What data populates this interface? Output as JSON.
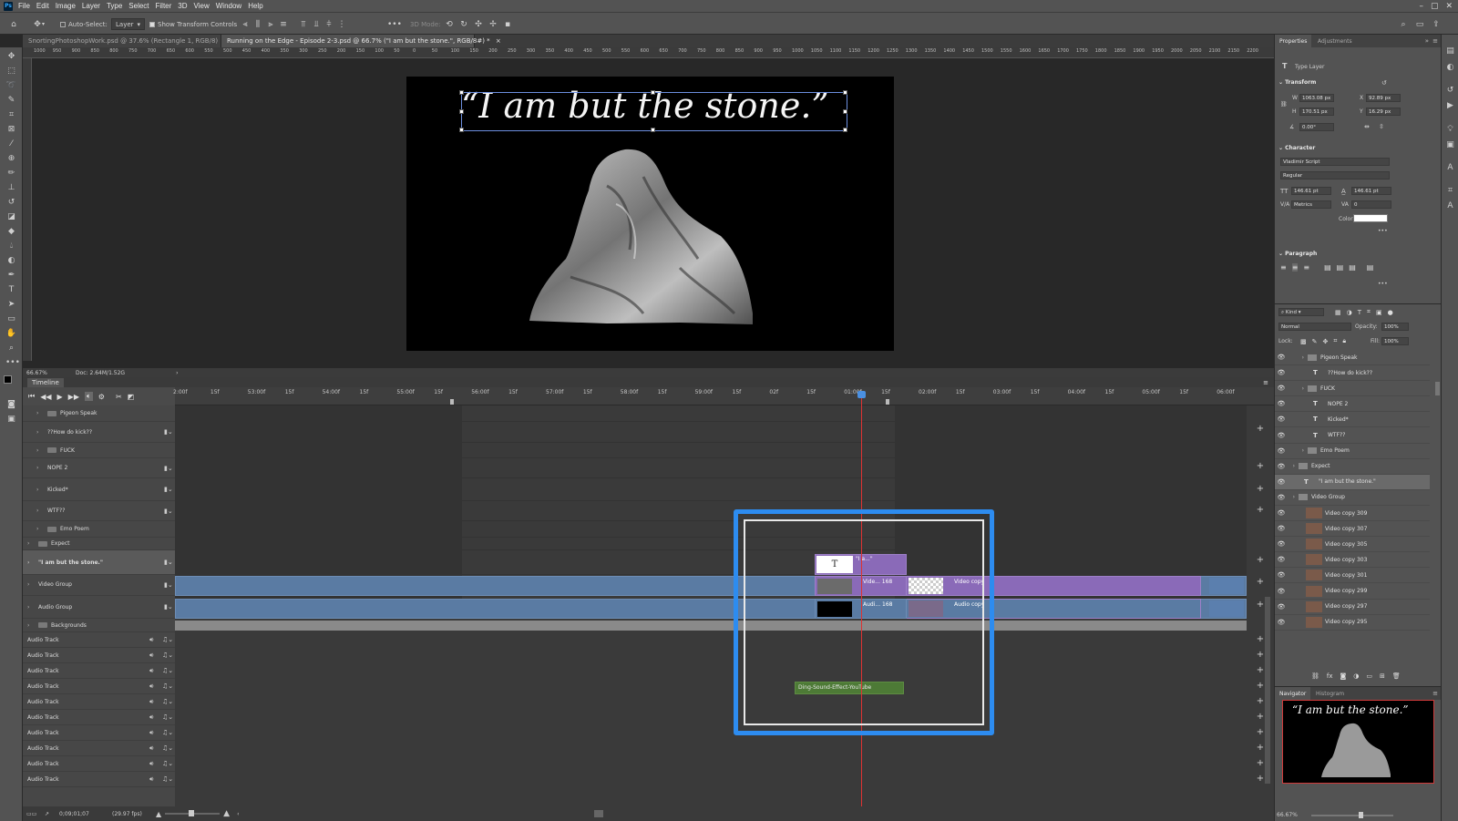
{
  "menu": [
    "File",
    "Edit",
    "Image",
    "Layer",
    "Type",
    "Select",
    "Filter",
    "3D",
    "View",
    "Window",
    "Help"
  ],
  "options": {
    "auto_select": "Auto-Select:",
    "layer_select": "Layer",
    "show_transform": "Show Transform Controls",
    "mode_3d": "3D Mode:"
  },
  "tabs": [
    {
      "label": "SnortingPhotoshopWork.psd @ 37.6% (Rectangle 1, RGB/8)",
      "active": false
    },
    {
      "label": "Running on the Edge - Episode 2-3.psd @ 66.7% (\"I am but the stone.\", RGB/8#) *",
      "active": true
    }
  ],
  "ruler_ticks": [
    "1000",
    "950",
    "900",
    "850",
    "800",
    "750",
    "700",
    "650",
    "600",
    "550",
    "500",
    "450",
    "400",
    "350",
    "300",
    "250",
    "200",
    "150",
    "100",
    "50",
    "0",
    "50",
    "100",
    "150",
    "200",
    "250",
    "300",
    "350",
    "400",
    "450",
    "500",
    "550",
    "600",
    "650",
    "700",
    "750",
    "800",
    "850",
    "900",
    "950",
    "1000",
    "1050",
    "1100",
    "1150",
    "1200",
    "1250",
    "1300",
    "1350",
    "1400",
    "1450",
    "1500",
    "1550",
    "1600",
    "1650",
    "1700",
    "1750",
    "1800",
    "1850",
    "1900",
    "1950",
    "2000",
    "2050",
    "2100",
    "2150",
    "2200"
  ],
  "canvas": {
    "quote": "“I am but the stone.”"
  },
  "status": {
    "zoom": "66.67%",
    "doc": "Doc: 2.64M/1.52G"
  },
  "timeline": {
    "title": "Timeline",
    "ruler": [
      "2:00f",
      "15f",
      "53:00f",
      "15f",
      "54:00f",
      "15f",
      "55:00f",
      "15f",
      "56:00f",
      "15f",
      "57:00f",
      "15f",
      "58:00f",
      "15f",
      "59:00f",
      "15f",
      "02f",
      "15f",
      "01:00f",
      "15f",
      "02:00f",
      "15f",
      "03:00f",
      "15f",
      "04:00f",
      "15f",
      "05:00f",
      "15f",
      "06:00f"
    ],
    "layers": [
      {
        "name": "Pigeon Speak",
        "type": "folder",
        "indent": 1
      },
      {
        "name": "??How do kick??",
        "type": "text",
        "indent": 1
      },
      {
        "name": "FUCK",
        "type": "folder",
        "indent": 1
      },
      {
        "name": "NOPE 2",
        "type": "text",
        "indent": 1
      },
      {
        "name": "Kicked*",
        "type": "text",
        "indent": 1
      },
      {
        "name": "WTF??",
        "type": "text",
        "indent": 1
      },
      {
        "name": "Emo Poem",
        "type": "folder",
        "indent": 1
      },
      {
        "name": "Expect",
        "type": "folder",
        "indent": 0
      },
      {
        "name": "\"I am but the stone.\"",
        "type": "text",
        "indent": 0,
        "selected": true
      },
      {
        "name": "Video Group",
        "type": "group",
        "indent": 0
      },
      {
        "name": "Audio Group",
        "type": "group",
        "indent": 0
      },
      {
        "name": "Backgrounds",
        "type": "folder",
        "indent": 0
      }
    ],
    "audio_track_label": "Audio Track",
    "audio_track_count": 10,
    "clips": {
      "text_clip": "\"I a...\"",
      "video1": "Vide... 168",
      "video2": "Video copy",
      "audio1": "Audi... 168",
      "audio2": "Audio copy",
      "sound": "Ding-Sound-Effect-YouTube"
    },
    "timecode": "0;09;01;07",
    "fps": "(29.97 fps)"
  },
  "properties": {
    "tab_properties": "Properties",
    "tab_adjustments": "Adjustments",
    "layer_kind": "Type Layer",
    "transform_label": "Transform",
    "W": "1063.08 px",
    "H": "170.51 px",
    "X": "92.89 px",
    "Y": "16.29 px",
    "angle": "0.00°",
    "character_label": "Character",
    "font": "Vladimir Script",
    "style": "Regular",
    "size": "146.61 pt",
    "leading": "146.61 pt",
    "kerning": "Metrics",
    "tracking": "0",
    "color_label": "Color",
    "paragraph_label": "Paragraph"
  },
  "layers_panel": {
    "kind": "Kind",
    "blend": "Normal",
    "opacity_label": "Opacity:",
    "opacity": "100%",
    "lock_label": "Lock:",
    "fill_label": "Fill:",
    "fill": "100%",
    "rows": [
      {
        "name": "Pigeon Speak",
        "type": "folder",
        "depth": 2
      },
      {
        "name": "??How do kick??",
        "type": "text",
        "depth": 2
      },
      {
        "name": "FUCK",
        "type": "folder",
        "depth": 2
      },
      {
        "name": "NOPE 2",
        "type": "text",
        "depth": 2
      },
      {
        "name": "Kicked*",
        "type": "text",
        "depth": 2
      },
      {
        "name": "WTF??",
        "type": "text",
        "depth": 2
      },
      {
        "name": "Emo Poem",
        "type": "folder",
        "depth": 2
      },
      {
        "name": "Expect",
        "type": "folder",
        "depth": 1
      },
      {
        "name": "\"I am but the stone.\"",
        "type": "text",
        "depth": 1,
        "selected": true
      },
      {
        "name": "Video Group",
        "type": "folder",
        "depth": 1
      },
      {
        "name": "Video copy 309",
        "type": "video",
        "depth": 2
      },
      {
        "name": "Video copy 307",
        "type": "video",
        "depth": 2
      },
      {
        "name": "Video copy 305",
        "type": "video",
        "depth": 2
      },
      {
        "name": "Video copy 303",
        "type": "video",
        "depth": 2
      },
      {
        "name": "Video copy 301",
        "type": "video",
        "depth": 2
      },
      {
        "name": "Video copy 299",
        "type": "video",
        "depth": 2
      },
      {
        "name": "Video copy 297",
        "type": "video",
        "depth": 2
      },
      {
        "name": "Video copy 295",
        "type": "video",
        "depth": 2
      }
    ]
  },
  "navigator": {
    "tab_navigator": "Navigator",
    "tab_histogram": "Histogram",
    "quote": "“I am but the stone.”",
    "zoom": "66.67%"
  }
}
